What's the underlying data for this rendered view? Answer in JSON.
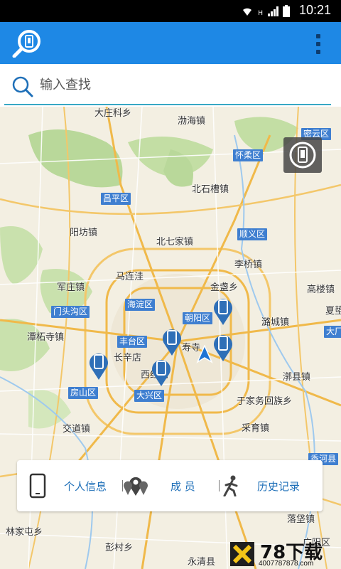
{
  "status_bar": {
    "time": "10:21",
    "network": "H"
  },
  "app_bar": {
    "logo_icon": "phone-search-icon",
    "menu_icon": "overflow-menu-icon"
  },
  "search": {
    "placeholder": "输入查找",
    "value": ""
  },
  "map": {
    "place_labels": [
      {
        "text": "大庄科乡"
      },
      {
        "text": "渤海镇"
      },
      {
        "text": "北石槽镇"
      },
      {
        "text": "阳坊镇"
      },
      {
        "text": "北七家镇"
      },
      {
        "text": "马连洼"
      },
      {
        "text": "李桥镇"
      },
      {
        "text": "军庄镇"
      },
      {
        "text": "金盏乡"
      },
      {
        "text": "高楼镇"
      },
      {
        "text": "潭柘寺镇"
      },
      {
        "text": "潞城镇"
      },
      {
        "text": "夏垫"
      },
      {
        "text": "长辛店"
      },
      {
        "text": "寿寺"
      },
      {
        "text": "西红门"
      },
      {
        "text": "漷县镇"
      },
      {
        "text": "于家务回族乡"
      },
      {
        "text": "交道镇"
      },
      {
        "text": "采育镇"
      },
      {
        "text": "林家屯乡"
      },
      {
        "text": "落垡镇"
      },
      {
        "text": "彭村乡"
      },
      {
        "text": "永清县"
      },
      {
        "text": "广阳区"
      }
    ],
    "district_labels": [
      {
        "text": "密云区"
      },
      {
        "text": "怀柔区"
      },
      {
        "text": "昌平区"
      },
      {
        "text": "顺义区"
      },
      {
        "text": "海淀区"
      },
      {
        "text": "门头沟区"
      },
      {
        "text": "朝阳区"
      },
      {
        "text": "丰台区"
      },
      {
        "text": "大兴区"
      },
      {
        "text": "房山区"
      },
      {
        "text": "大厂"
      },
      {
        "text": "香河县"
      }
    ],
    "member_pin_icon": "phone-pin-icon",
    "my_location_icon": "navigation-arrow-icon",
    "floating_button_icon": "phone-locate-icon"
  },
  "bottom_panel": {
    "items": [
      {
        "label": "个人信息",
        "icon": "phone-icon"
      },
      {
        "label": "成 员",
        "icon": "map-pins-icon"
      },
      {
        "label": "历史记录",
        "icon": "walking-person-icon"
      }
    ]
  },
  "watermark": {
    "brand": "78下载",
    "url": "4007787878.com"
  },
  "colors": {
    "app_bar": "#1e88e5",
    "accent_text": "#1e6fb8",
    "pin": "#2f6fb7",
    "district_tag": "#3f7fd0",
    "road_major": "#f0b94a",
    "park_green": "#b9d89a"
  }
}
